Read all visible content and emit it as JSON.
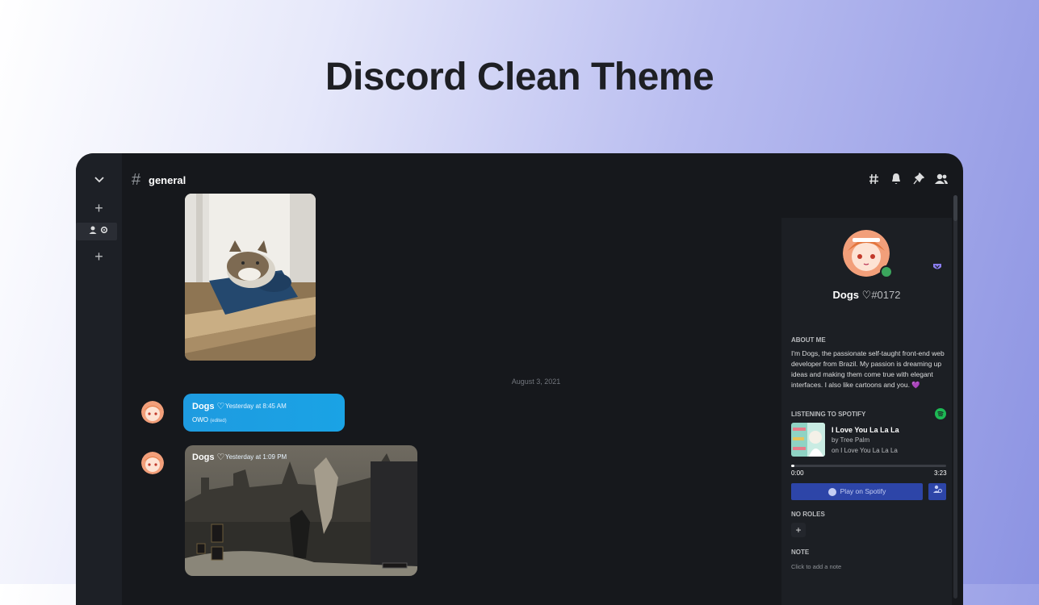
{
  "headline": "Discord Clean Theme",
  "colors": {
    "accent": "#1e9be0",
    "spotify": "#1db954",
    "online": "#3ba55d",
    "button": "#2d45a8"
  },
  "rail": {
    "icons": [
      "chevron-down-icon",
      "plus-icon",
      "add-friend-settings-icon",
      "plus-icon"
    ]
  },
  "channel": {
    "hash": "#",
    "name": "general"
  },
  "toolbar": {
    "icons": [
      "threads-icon",
      "bell-icon",
      "pin-icon",
      "members-icon"
    ]
  },
  "messages": {
    "date_divider": "August 3, 2021",
    "msg1": {
      "username": "Dogs ♡",
      "timestamp": "Yesterday at 8:45 AM",
      "text": "OWO",
      "edited": "(edited)"
    },
    "msg2": {
      "username": "Dogs ♡",
      "timestamp": "Yesterday at 1:09 PM"
    }
  },
  "profile": {
    "name": "Dogs ♡",
    "tag": "#0172",
    "about_heading": "ABOUT ME",
    "about_text": "I'm Dogs, the passionate self-taught front-end web developer from Brazil. My passion is dreaming up ideas and making them come true with elegant interfaces. I also like cartoons and you. 💜",
    "spotify_heading": "LISTENING TO SPOTIFY",
    "song": "I Love You La La La",
    "artist": "by Tree Palm",
    "album": "on I Love You La La La",
    "time_current": "0:00",
    "time_total": "3:23",
    "progress": 0.01,
    "play_button": "Play on Spotify",
    "roles_heading": "NO ROLES",
    "note_heading": "NOTE",
    "note_placeholder": "Click to add a note"
  }
}
